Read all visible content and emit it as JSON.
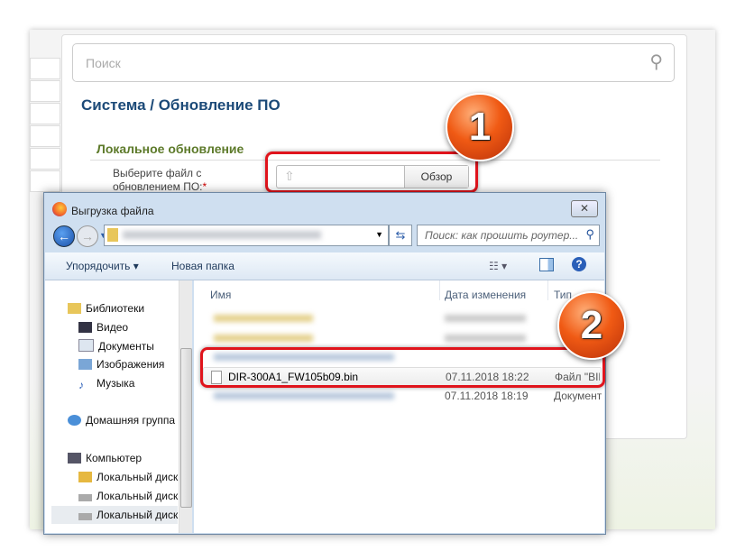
{
  "web": {
    "search_placeholder": "Поиск",
    "breadcrumb": "Система /  Обновление ПО",
    "section": "Локальное обновление",
    "file_label": "Выберите файл с обновлением ПО:",
    "required": "*",
    "browse": "Обзор"
  },
  "badges": [
    "1",
    "2"
  ],
  "dialog": {
    "title": "Выгрузка файла",
    "search_placeholder": "Поиск: как прошить роутер...",
    "organize": "Упорядочить ▾",
    "new_folder": "Новая папка",
    "nav": [
      "Библиотеки",
      "Видео",
      "Документы",
      "Изображения",
      "Музыка",
      "Домашняя группа",
      "Компьютер",
      "Локальный диск",
      "Локальный диск",
      "Локальный диск"
    ],
    "columns": [
      "Имя",
      "Дата изменения",
      "Тип"
    ],
    "files": [
      {
        "name": "DIR-300A1_FW105b09.bin",
        "date": "07.11.2018 18:22",
        "type": "Файл \"BIN\""
      },
      {
        "name": "",
        "date": "07.11.2018 18:19",
        "type": "Документ"
      }
    ]
  }
}
